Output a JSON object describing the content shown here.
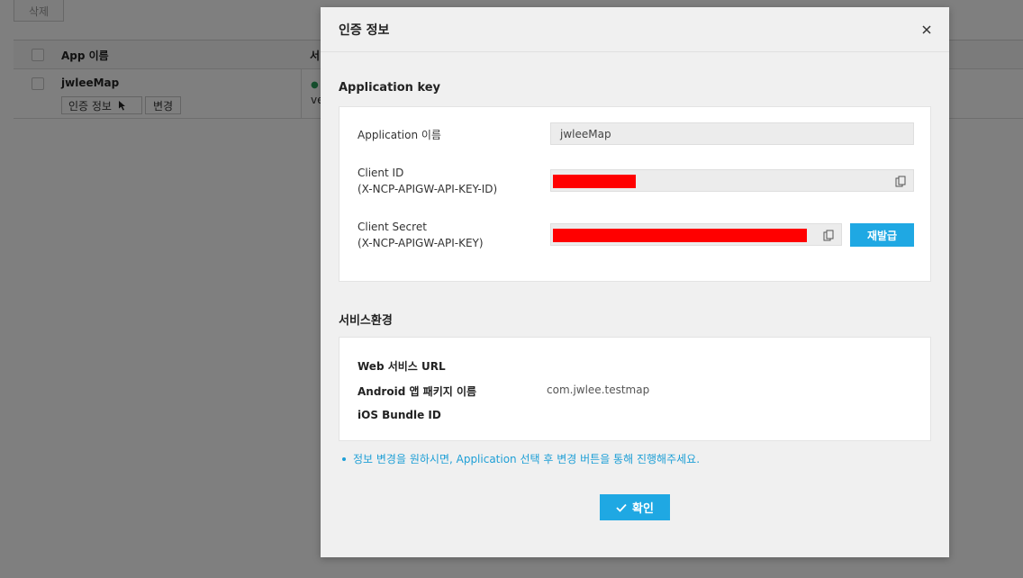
{
  "background": {
    "delete_label": "삭제",
    "table": {
      "col_app": "App 이름",
      "col_service": "서",
      "row": {
        "app_name": "jwleeMap",
        "auth_button": "인증 정보",
        "edit_button": "변경",
        "service_text": "ve"
      }
    }
  },
  "modal": {
    "title": "인증 정보",
    "app_key_section": {
      "title": "Application key",
      "app_name_label": "Application 이름",
      "app_name_value": "jwleeMap",
      "client_id_label_1": "Client ID",
      "client_id_label_2": "(X-NCP-APIGW-API-KEY-ID)",
      "client_secret_label_1": "Client Secret",
      "client_secret_label_2": "(X-NCP-APIGW-API-KEY)",
      "reissue_label": "재발급"
    },
    "service_section": {
      "title": "서비스환경",
      "web_url_label": "Web 서비스 URL",
      "android_label": "Android 앱 패키지 이름",
      "android_value": "com.jwlee.testmap",
      "ios_label": "iOS Bundle ID"
    },
    "note": "정보 변경을 원하시면, Application 선택 후 변경 버튼을 통해 진행해주세요.",
    "confirm_label": "확인"
  },
  "colors": {
    "accent": "#1fa8e3",
    "redaction": "#ff0000",
    "note_text": "#1e9fd6"
  }
}
